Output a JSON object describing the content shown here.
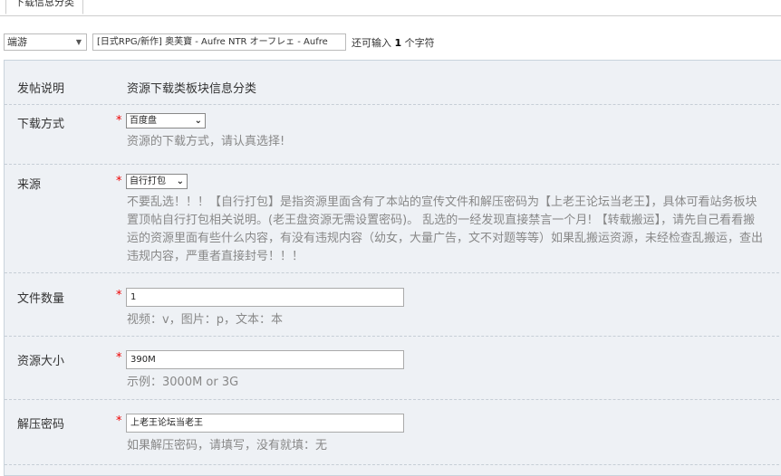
{
  "tab": {
    "label": "下载信息分类"
  },
  "title_row": {
    "type_select": "端游",
    "title_value": "[日式RPG/新作] 奥芙寶 - Aufre NTR オーフレェ - Aufre",
    "remaining_prefix": "还可输入",
    "remaining_count": "1",
    "remaining_suffix": "个字符"
  },
  "form": {
    "intro": {
      "label": "发帖说明",
      "value": "资源下载类板块信息分类"
    },
    "download_method": {
      "label": "下载方式",
      "required": "*",
      "selected": "百度盘",
      "hint": "资源的下载方式，请认真选择!"
    },
    "source": {
      "label": "来源",
      "required": "*",
      "selected": "自行打包",
      "hint_lines": [
        "不要乱选！！！【自行打包】是指资源里面含有了本站的宣传文件和解压密码为【上老王论坛当老王】，具体可看站务板块",
        "置顶帖自行打包相关说明。(老王盘资源无需设置密码)。 乱选的一经发现直接禁言一个月! 【转载搬运】，请先自己看看搬",
        "运的资源里面有些什么内容，有没有违规内容（幼女，大量广告，文不对题等等）如果乱搬运资源，未经检查乱搬运，查出",
        "违规内容，严重者直接封号！！！"
      ]
    },
    "file_count": {
      "label": "文件数量",
      "required": "*",
      "value": "1",
      "hint": "视频：v，图片：p，文本：本"
    },
    "size": {
      "label": "资源大小",
      "required": "*",
      "value": "390M",
      "hint": "示例：3000M or 3G"
    },
    "password": {
      "label": "解压密码",
      "required": "*",
      "value": "上老王论坛当老王",
      "hint": "如果解压密码，请填写，没有就填：无"
    }
  }
}
